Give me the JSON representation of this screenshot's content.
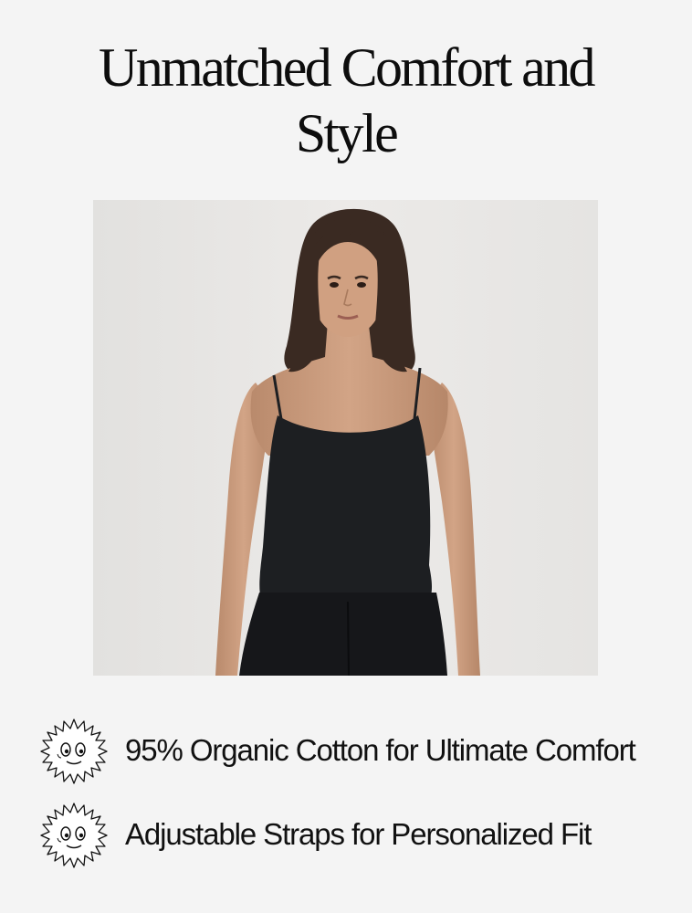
{
  "headline": {
    "line1": "Unmatched Comfort and",
    "line2": "Style"
  },
  "features": [
    {
      "icon": "smiley-sun-icon",
      "text": "95% Organic Cotton for Ultimate Comfort"
    },
    {
      "icon": "smiley-sun-icon",
      "text": "Adjustable Straps for Personalized Fit"
    }
  ],
  "colors": {
    "background": "#f4f4f4",
    "text": "#111111",
    "garment": "#1d1f22",
    "photo_backdrop": "#e7e6e4"
  }
}
